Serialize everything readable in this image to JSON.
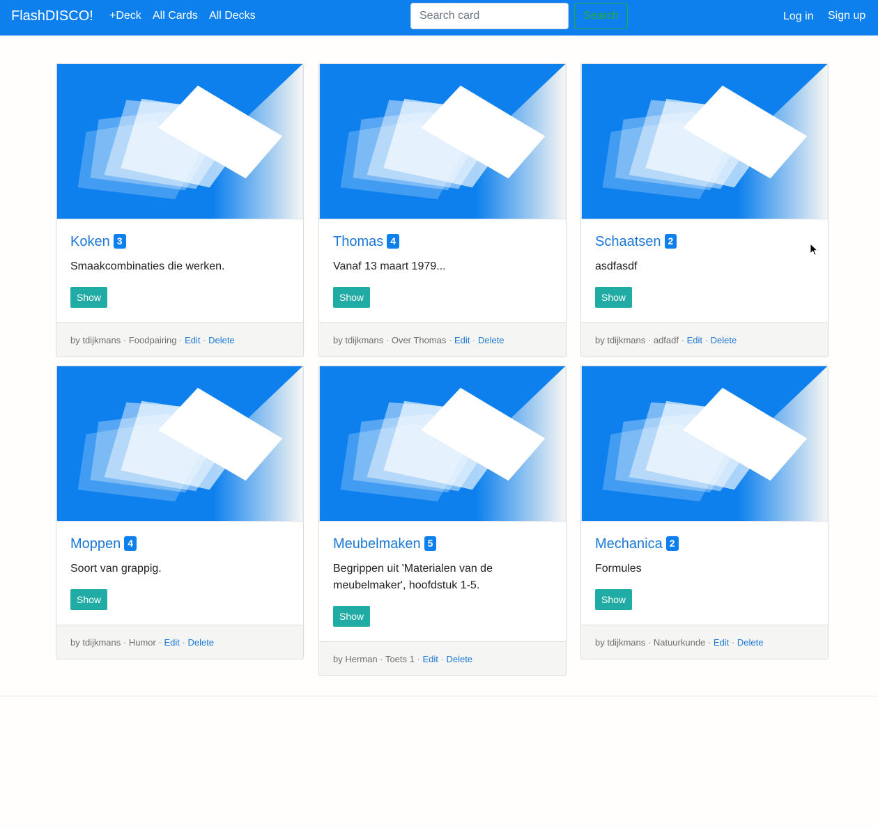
{
  "navbar": {
    "brand": "FlashDISCO!",
    "links": [
      "+Deck",
      "All Cards",
      "All Decks"
    ],
    "search_placeholder": "Search card",
    "search_button": "Search",
    "login": "Log in",
    "signup": "Sign up"
  },
  "colors": {
    "navbar": "#0d80ee",
    "link": "#1a78d7",
    "show_button": "#20aba4",
    "search_button": "#28a745"
  },
  "separator": "·",
  "decks": [
    {
      "title": "Koken",
      "count": "3",
      "description": "Smaakcombinaties die werken.",
      "show": "Show",
      "author": "by tdijkmans",
      "category": "Foodpairing",
      "edit": "Edit",
      "delete": "Delete"
    },
    {
      "title": "Thomas",
      "count": "4",
      "description": "Vanaf 13 maart 1979...",
      "show": "Show",
      "author": "by tdijkmans",
      "category": "Over Thomas",
      "edit": "Edit",
      "delete": "Delete"
    },
    {
      "title": "Schaatsen",
      "count": "2",
      "description": "asdfasdf",
      "show": "Show",
      "author": "by tdijkmans",
      "category": "adfadf",
      "edit": "Edit",
      "delete": "Delete"
    },
    {
      "title": "Moppen",
      "count": "4",
      "description": "Soort van grappig.",
      "show": "Show",
      "author": "by tdijkmans",
      "category": "Humor",
      "edit": "Edit",
      "delete": "Delete"
    },
    {
      "title": "Meubelmaken",
      "count": "5",
      "description": "Begrippen uit 'Materialen van de meubelmaker', hoofdstuk 1-5.",
      "show": "Show",
      "author": "by Herman",
      "category": "Toets 1",
      "edit": "Edit",
      "delete": "Delete"
    },
    {
      "title": "Mechanica",
      "count": "2",
      "description": "Formules",
      "show": "Show",
      "author": "by tdijkmans",
      "category": "Natuurkunde",
      "edit": "Edit",
      "delete": "Delete"
    }
  ]
}
